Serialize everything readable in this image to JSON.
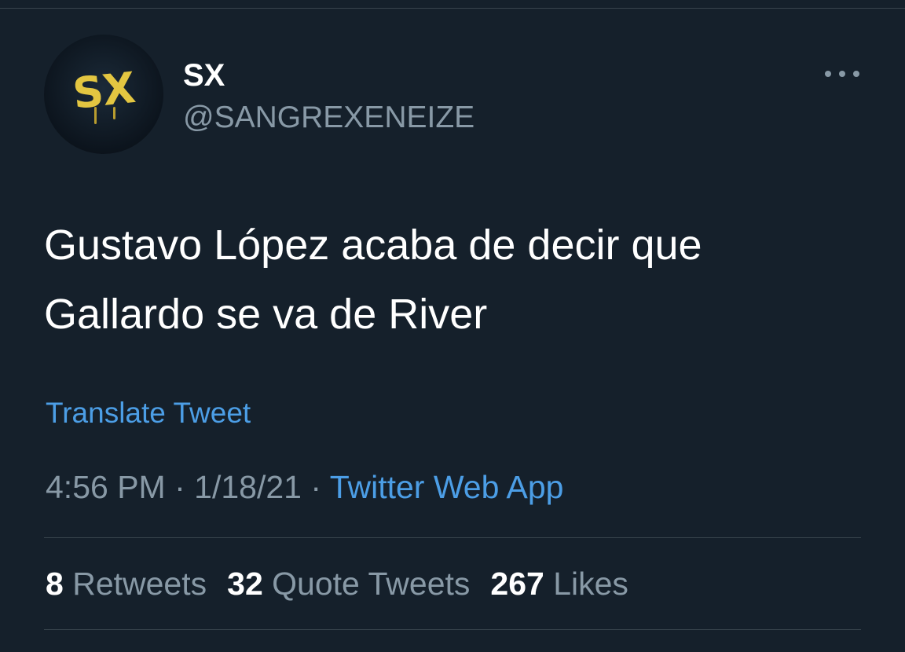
{
  "tweet": {
    "avatar_text": "SX",
    "display_name": "SX",
    "handle": "@SANGREXENEIZE",
    "text_line1": "Gustavo López acaba de decir que",
    "text_line2": "Gallardo se va de River",
    "translate_label": "Translate Tweet",
    "time": "4:56 PM",
    "date": "1/18/21",
    "source": "Twitter Web App",
    "separator": "·",
    "more_icon": "more-horizontal-icon"
  },
  "stats": {
    "retweets_count": "8",
    "retweets_label": "Retweets",
    "quotes_count": "32",
    "quotes_label": "Quote Tweets",
    "likes_count": "267",
    "likes_label": "Likes"
  },
  "colors": {
    "background": "#15202b",
    "accent": "#4c9ee6",
    "secondary_text": "#8899a6",
    "avatar_text": "#e3c641"
  }
}
